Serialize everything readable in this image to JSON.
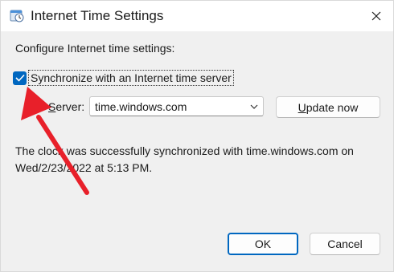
{
  "window": {
    "title": "Internet Time Settings",
    "close_icon": "close-icon"
  },
  "content": {
    "heading": "Configure Internet time settings:",
    "sync_checkbox": {
      "label": "Synchronize with an Internet time server",
      "checked": true
    },
    "server": {
      "label_prefix": "S",
      "label_rest": "erver:",
      "value": "time.windows.com"
    },
    "update_button": {
      "label_prefix": "U",
      "label_rest": "pdate now"
    },
    "status_message": "The clock was successfully synchronized with time.windows.com on Wed/2/23/2022 at 5:13 PM."
  },
  "buttons": {
    "ok": "OK",
    "cancel": "Cancel"
  },
  "colors": {
    "accent": "#0067c0",
    "annotation_arrow": "#e8202a"
  }
}
